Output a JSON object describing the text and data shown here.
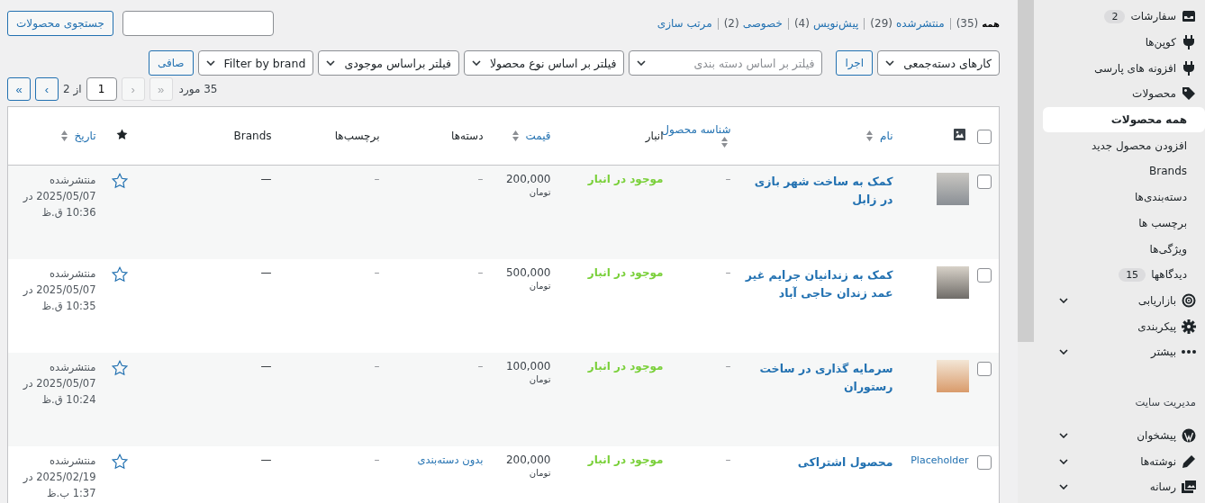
{
  "sidebar": {
    "items": [
      {
        "kind": "menu",
        "label": "سفارشات",
        "badge": "2",
        "selected": false
      },
      {
        "kind": "menu",
        "label": "کوپن‌ها",
        "selected": false
      },
      {
        "kind": "menu",
        "label": "افزونه های پارسی",
        "selected": false
      },
      {
        "kind": "menu",
        "label": "محصولات",
        "selected": false
      },
      {
        "kind": "sub",
        "label": "همه محصولات",
        "selected": true
      },
      {
        "kind": "sub",
        "label": "افزودن محصول جدید",
        "selected": false
      },
      {
        "kind": "sub",
        "label": "Brands",
        "selected": false
      },
      {
        "kind": "sub",
        "label": "دسته‌بندی‌ها",
        "selected": false
      },
      {
        "kind": "sub",
        "label": "برچسب ها",
        "selected": false
      },
      {
        "kind": "sub",
        "label": "ویژگی‌ها",
        "selected": false
      },
      {
        "kind": "sub",
        "label": "دیدگاهها",
        "badge": "15",
        "selected": false
      },
      {
        "kind": "menu",
        "label": "بازاریابی",
        "expandable": true,
        "selected": false
      },
      {
        "kind": "menu",
        "label": "پیکربندی",
        "selected": false
      },
      {
        "kind": "menu",
        "label": "بیشتر",
        "expandable": true,
        "selected": false
      },
      {
        "kind": "heading",
        "label": "مدیریت سایت"
      },
      {
        "kind": "menu",
        "label": "پیشخوان",
        "expandable": true,
        "selected": false
      },
      {
        "kind": "menu",
        "label": "نوشته‌ها",
        "expandable": true,
        "selected": false
      },
      {
        "kind": "menu",
        "label": "رسانه",
        "expandable": true,
        "selected": false
      }
    ]
  },
  "status_links": [
    {
      "label": "همه",
      "count": "(35)",
      "selected": true
    },
    {
      "label": "منتشرشده",
      "count": "(29)",
      "selected": false
    },
    {
      "label": "پیش‌نویس",
      "count": "(4)",
      "selected": false
    },
    {
      "label": "خصوصی",
      "count": "(2)",
      "selected": false
    },
    {
      "label": "مرتب سازی",
      "selected": false
    }
  ],
  "search": {
    "button": "جستجوی محصولات"
  },
  "filters": [
    {
      "kind": "select",
      "value": "کارهای دسته‌جمعی"
    },
    {
      "kind": "button",
      "label": "اجرا"
    },
    {
      "kind": "select",
      "placeholder": "فیلتر بر اساس دسته بندی"
    },
    {
      "kind": "select",
      "value": "فیلتر بر اساس نوع محصولا"
    },
    {
      "kind": "select",
      "value": "فیلتر براساس موجودی"
    },
    {
      "kind": "select",
      "value": "Filter by brand"
    },
    {
      "kind": "button",
      "label": "صافی"
    }
  ],
  "pagination": {
    "count": "35 مورد",
    "first": "«",
    "prev": "‹",
    "page": "1",
    "of": "از 2",
    "next": "›",
    "last": "»",
    "prev_disabled": true,
    "next_disabled": false
  },
  "table": {
    "select_all_checked": false,
    "columns": [
      {
        "kind": "check"
      },
      {
        "kind": "image"
      },
      {
        "kind": "text",
        "label": "نام",
        "sortable": true
      },
      {
        "kind": "text",
        "label": "شناسه محصول",
        "sortable": true
      },
      {
        "kind": "text",
        "label": "انبار",
        "sortable": false
      },
      {
        "kind": "text",
        "label": "قیمت",
        "sortable": true
      },
      {
        "kind": "text",
        "label": "دسته‌ها",
        "sortable": false
      },
      {
        "kind": "text",
        "label": "برچسب‌ها",
        "sortable": false
      },
      {
        "kind": "text",
        "label": "Brands",
        "sortable": false
      },
      {
        "kind": "featured"
      },
      {
        "kind": "text",
        "label": "تاریخ",
        "sortable": true
      }
    ],
    "rows": [
      {
        "checked": false,
        "name": "کمک به ساخت شهر بازی در زابل",
        "sku": "–",
        "stock": "موجود در انبار",
        "price": "200,000",
        "currency": "تومان",
        "categories": "–",
        "categories_link": false,
        "tags": "–",
        "brands": "—",
        "featured": false,
        "status": "منتشرشده",
        "date": "2025/05/07 در 10:36 ق.ظ"
      },
      {
        "checked": false,
        "name": "کمک به زندانیان جرایم غیر عمد زندان حاجی آباد",
        "sku": "–",
        "stock": "موجود در انبار",
        "price": "500,000",
        "currency": "تومان",
        "categories": "–",
        "categories_link": false,
        "tags": "–",
        "brands": "—",
        "featured": false,
        "status": "منتشرشده",
        "date": "2025/05/07 در 10:35 ق.ظ"
      },
      {
        "checked": false,
        "name": "سرمایه گذاری در ساخت رستوران",
        "sku": "–",
        "stock": "موجود در انبار",
        "price": "100,000",
        "currency": "تومان",
        "categories": "–",
        "categories_link": false,
        "tags": "–",
        "brands": "—",
        "featured": false,
        "status": "منتشرشده",
        "date": "2025/05/07 در 10:24 ق.ظ"
      },
      {
        "checked": false,
        "thumb_text": "Placeholder",
        "name": "محصول اشتراکی",
        "sku": "–",
        "stock": "موجود در انبار",
        "price": "200,000",
        "currency": "تومان",
        "categories": "بدون دسته‌بندی",
        "categories_link": true,
        "tags": "–",
        "brands": "—",
        "featured": false,
        "status": "منتشرشده",
        "date": "2025/02/19 در 1:37 ب.ظ"
      }
    ]
  }
}
